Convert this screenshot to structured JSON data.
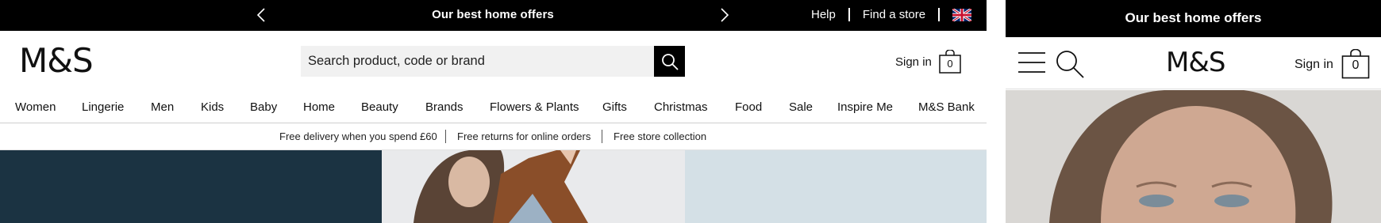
{
  "desktop": {
    "promo": {
      "text": "Our best home offers"
    },
    "utility_links": [
      "Help",
      "Find a store"
    ],
    "logo": "M&S",
    "search": {
      "placeholder": "Search product, code or brand"
    },
    "sign_in": "Sign in",
    "bag_count": "0",
    "nav": [
      "Women",
      "Lingerie",
      "Men",
      "Kids",
      "Baby",
      "Home",
      "Beauty",
      "Brands",
      "Flowers & Plants",
      "Gifts",
      "Christmas",
      "Food",
      "Sale",
      "Inspire Me",
      "M&S Bank"
    ],
    "services": [
      "Free delivery when you spend £60",
      "Free returns for online orders",
      "Free store collection"
    ],
    "colors": {
      "promo_bg": "#000000",
      "hero_left": "#1b3342",
      "hero_right": "#d4e0e6"
    }
  },
  "mobile": {
    "promo": {
      "text": "Our best home offers"
    },
    "logo": "M&S",
    "sign_in": "Sign in",
    "bag_count": "0"
  },
  "icons": [
    "chevron-left-icon",
    "chevron-right-icon",
    "uk-flag-icon",
    "search-icon",
    "shopping-bag-icon",
    "hamburger-menu-icon"
  ]
}
